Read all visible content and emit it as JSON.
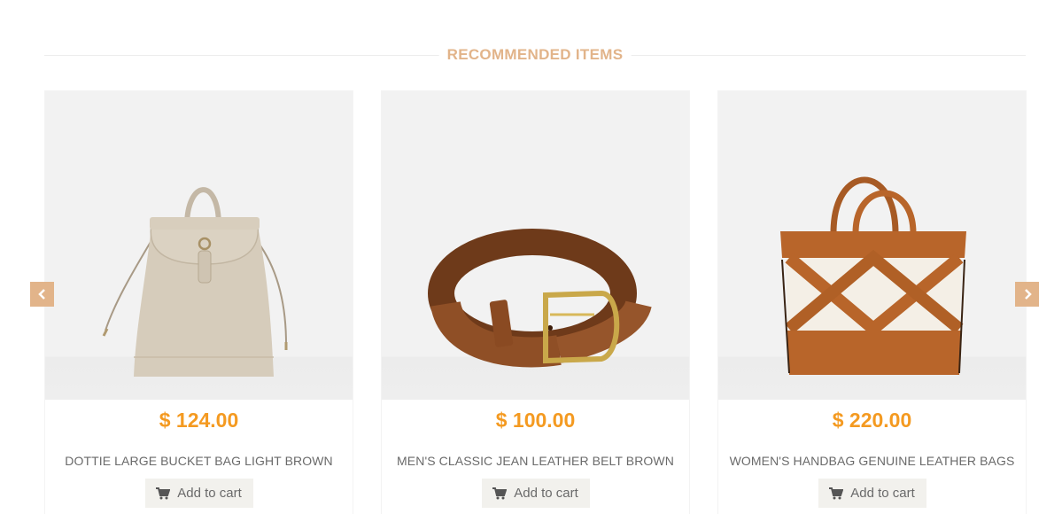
{
  "section": {
    "title": "RECOMMENDED ITEMS"
  },
  "products": [
    {
      "price": "$ 124.00",
      "name": "DOTTIE LARGE BUCKET BAG LIGHT BROWN",
      "cart_label": "Add to cart",
      "image": "beige-backpack"
    },
    {
      "price": "$ 100.00",
      "name": "MEN'S CLASSIC JEAN LEATHER BELT BROWN",
      "cart_label": "Add to cart",
      "image": "brown-leather-belt"
    },
    {
      "price": "$ 220.00",
      "name": "WOMEN'S HANDBAG GENUINE LEATHER BAGS",
      "cart_label": "Add to cart",
      "image": "woven-leather-bucket-bag"
    }
  ],
  "carousel": {
    "prev_icon": "chevron-left-icon",
    "next_icon": "chevron-right-icon"
  },
  "colors": {
    "accent": "#e2b48a",
    "price": "#f49a21",
    "text": "#6a6a6a",
    "button_bg": "#f2f1ed"
  }
}
